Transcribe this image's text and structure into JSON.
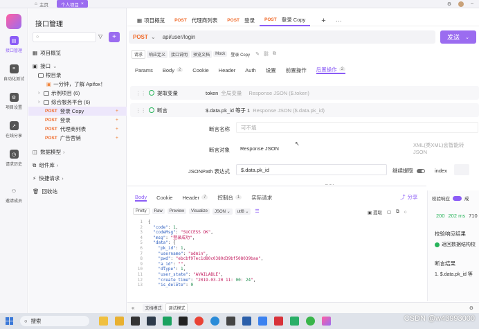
{
  "titlebar": {
    "tabs": [
      {
        "label": "主页"
      },
      {
        "label": "个人项目"
      }
    ]
  },
  "rail": {
    "items": [
      {
        "label": "接口管理"
      },
      {
        "label": "自动化测试"
      },
      {
        "label": "项目设置"
      },
      {
        "label": "在线分享"
      },
      {
        "label": "请求历史"
      },
      {
        "label": "邀请成员"
      }
    ]
  },
  "tree": {
    "title": "接口管理",
    "search_placeholder": "",
    "rows": [
      {
        "label": "项目概览"
      },
      {
        "label": "接口"
      },
      {
        "label": "根目录"
      },
      {
        "label": "一分钟，了解 Apifox！"
      },
      {
        "label": "示例项目 (6)"
      },
      {
        "label": "综合服务平台 (6)"
      },
      {
        "method": "POST",
        "label": "登录 Copy"
      },
      {
        "method": "POST",
        "label": "登录"
      },
      {
        "method": "POST",
        "label": "代理商列表"
      },
      {
        "method": "POST",
        "label": "广告营销"
      },
      {
        "label": "数据模型"
      },
      {
        "label": "组件库"
      },
      {
        "label": "快捷请求"
      },
      {
        "label": "回收站"
      }
    ]
  },
  "main_tabs": [
    {
      "method": "",
      "label": "项目概览"
    },
    {
      "method": "POST",
      "label": "代理商列表"
    },
    {
      "method": "POST",
      "label": "登录"
    },
    {
      "method": "POST",
      "label": "登录 Copy"
    }
  ],
  "request": {
    "method": "POST",
    "url": "api/user/login",
    "send_label": "发送"
  },
  "doc_tabs": [
    "请求",
    "响应定义",
    "接口说明",
    "预览文档",
    "Mock",
    "登录 Copy"
  ],
  "req_tabs": [
    {
      "label": "Params",
      "count": ""
    },
    {
      "label": "Body",
      "count": "2"
    },
    {
      "label": "Cookie",
      "count": ""
    },
    {
      "label": "Header",
      "count": ""
    },
    {
      "label": "Auth",
      "count": ""
    },
    {
      "label": "设置",
      "count": ""
    },
    {
      "label": "前置操作",
      "count": ""
    },
    {
      "label": "后置操作",
      "count": "2"
    }
  ],
  "post_ops": {
    "extract": {
      "label": "提取变量",
      "var": "token",
      "scope": "全局变量",
      "source": "Response JSON ($.token)"
    },
    "assert": {
      "label": "断言",
      "expr": "$.data.pk_id 等于 1",
      "source": "Response JSON ($.data.pk_id)"
    },
    "form": {
      "name_label": "断言名称",
      "name_placeholder": "可不填",
      "object_label": "断言对象",
      "object_value": "Response JSON",
      "object_hint": "XML(类XML)会智能转 JSON",
      "jsonpath_label": "JSONPath 表达式",
      "jsonpath_value": "$.data.pk_id",
      "continue_label": "继续提取",
      "index_label": "index"
    }
  },
  "response": {
    "tabs": [
      {
        "label": "Body",
        "count": ""
      },
      {
        "label": "Cookie",
        "count": ""
      },
      {
        "label": "Header",
        "count": "7"
      },
      {
        "label": "控制台",
        "count": "1"
      },
      {
        "label": "实际请求",
        "count": ""
      }
    ],
    "share_label": "分享",
    "toolbar": [
      "Pretty",
      "Raw",
      "Preview",
      "Visualize",
      "JSON",
      "utf8"
    ],
    "extract_label": "提取",
    "code_lines": [
      {
        "n": "1",
        "text": "{"
      },
      {
        "n": "2",
        "text": "  \"code\": 1,"
      },
      {
        "n": "3",
        "text": "  \"codeMsg\": \"SUCCESS OK\","
      },
      {
        "n": "4",
        "text": "  \"msg\": \"登录成功\","
      },
      {
        "n": "5",
        "text": "  \"data\": {"
      },
      {
        "n": "6",
        "text": "    \"pk_id\": 1,"
      },
      {
        "n": "7",
        "text": "    \"username\": \"admin\","
      },
      {
        "n": "8",
        "text": "    \"pwd\": \"ebcbf97ec1d80c0380d39bf508039baa\","
      },
      {
        "n": "9",
        "text": "    \"a_id\": \"\","
      },
      {
        "n": "10",
        "text": "    \"dtype\": 1,"
      },
      {
        "n": "11",
        "text": "    \"user_state\": \"AVAILABLE\","
      },
      {
        "n": "12",
        "text": "    \"create_time\": \"2019-03-20 11:00:24\","
      },
      {
        "n": "13",
        "text": "    \"is_delete\": 0"
      }
    ]
  },
  "right_panel": {
    "validate_label": "校验响应",
    "status": "200",
    "time": "202 ms",
    "size": "710",
    "validate_result_label": "校验响应结果",
    "validate_result_text": "返回数据结构校",
    "assert_result_label": "断言结果",
    "assert_result_text": "1. $.data.pk_id 等"
  },
  "bottom_bar": {
    "doc_mode": "文档模式",
    "debug_mode": "调试模式"
  },
  "taskbar": {
    "search_label": "搜索",
    "watermark": "CSDN @w43993000"
  },
  "colors": {
    "accent": "#8b5cf6",
    "post": "#f06a2a",
    "success": "#27b35a"
  }
}
